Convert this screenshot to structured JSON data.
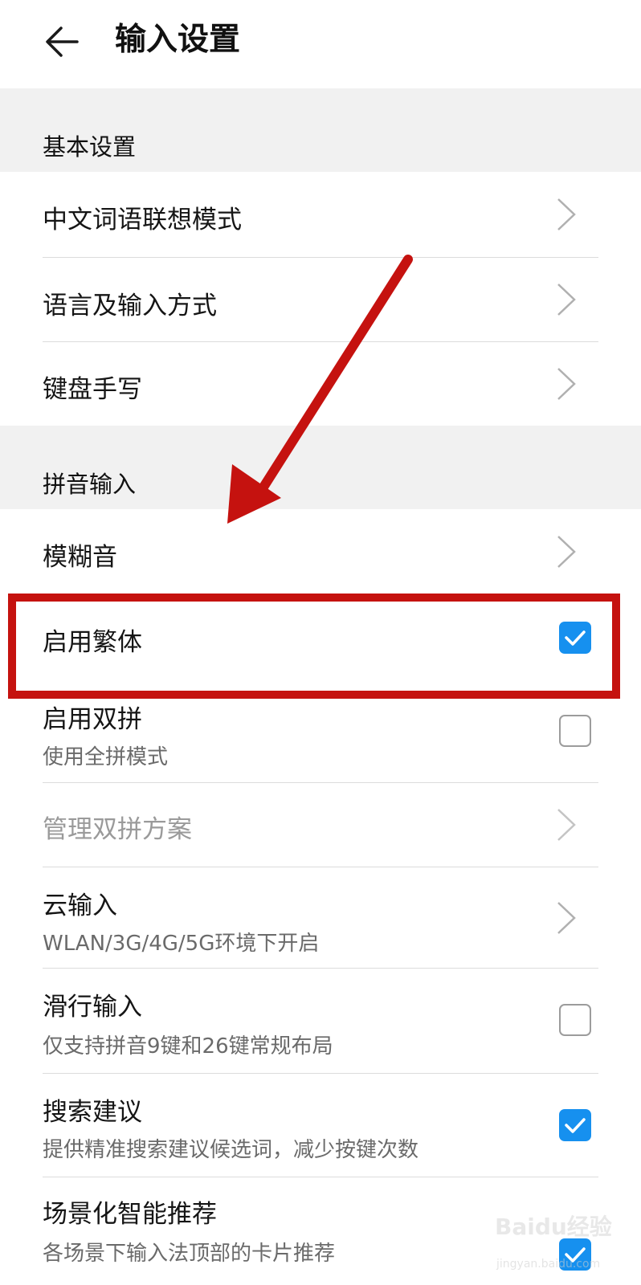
{
  "header": {
    "title": "输入设置",
    "back_icon": "arrow-left-icon"
  },
  "sections": {
    "basic": {
      "title": "基本设置",
      "items": [
        {
          "label": "中文词语联想模式",
          "control": "chevron"
        },
        {
          "label": "语言及输入方式",
          "control": "chevron"
        },
        {
          "label": "键盘手写",
          "control": "chevron"
        }
      ]
    },
    "pinyin": {
      "title": "拼音输入",
      "items": [
        {
          "label": "模糊音",
          "control": "chevron"
        },
        {
          "label": "启用繁体",
          "control": "checkbox",
          "checked": true
        },
        {
          "label": "启用双拼",
          "sublabel": "使用全拼模式",
          "control": "checkbox",
          "checked": false
        },
        {
          "label": "管理双拼方案",
          "control": "chevron",
          "disabled": true
        },
        {
          "label": "云输入",
          "sublabel": "WLAN/3G/4G/5G环境下开启",
          "control": "chevron"
        },
        {
          "label": "滑行输入",
          "sublabel": "仅支持拼音9键和26键常规布局",
          "control": "checkbox",
          "checked": false
        },
        {
          "label": "搜索建议",
          "sublabel": "提供精准搜索建议候选词，减少按键次数",
          "control": "checkbox",
          "checked": true
        },
        {
          "label": "场景化智能推荐",
          "sublabel": "各场景下输入法顶部的卡片推荐",
          "control": "checkbox",
          "checked": true
        }
      ]
    }
  },
  "annotation": {
    "color": "#c5120f",
    "highlighted_item": "启用繁体"
  },
  "watermark": {
    "text": "Baidu经验",
    "url": "jingyan.baidu.com"
  },
  "colors": {
    "accent": "#1690ef",
    "section_bg": "#f1f1f1",
    "annotation": "#c5120f"
  }
}
